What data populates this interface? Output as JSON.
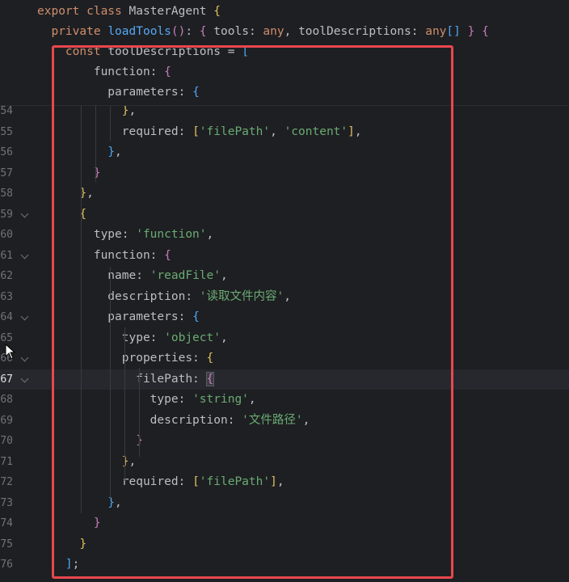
{
  "sticky_lines": [
    {
      "parts": [
        [
          "kw",
          "export "
        ],
        [
          "kw",
          "class "
        ],
        [
          "cls",
          "MasterAgent "
        ],
        [
          "br1",
          "{"
        ]
      ]
    },
    {
      "parts": [
        [
          "kw",
          "  private "
        ],
        [
          "fn",
          "loadTools"
        ],
        [
          "br2",
          "()"
        ],
        [
          "key",
          ": "
        ],
        [
          "br2",
          "{ "
        ],
        [
          "key",
          "tools: "
        ],
        [
          "kw",
          "any"
        ],
        [
          "key",
          ", toolDescriptions: "
        ],
        [
          "kw",
          "any"
        ],
        [
          "br3",
          "[]"
        ],
        [
          "br2",
          " }"
        ],
        [
          "key",
          " "
        ],
        [
          "br2",
          "{"
        ]
      ]
    },
    {
      "parts": [
        [
          "kw",
          "    const "
        ],
        [
          "key",
          "toolDescriptions = "
        ],
        [
          "br3",
          "["
        ]
      ]
    },
    {
      "parts": [
        [
          "key",
          "        function: "
        ],
        [
          "br2",
          "{"
        ]
      ]
    },
    {
      "parts": [
        [
          "key",
          "          parameters: "
        ],
        [
          "br3",
          "{"
        ]
      ]
    }
  ],
  "lines": [
    {
      "num": "54",
      "fold": false,
      "parts": [
        [
          "br1",
          "            }"
        ],
        [
          "key",
          ","
        ]
      ]
    },
    {
      "num": "55",
      "fold": false,
      "parts": [
        [
          "key",
          "            required: "
        ],
        [
          "br1",
          "["
        ],
        [
          "str",
          "'filePath'"
        ],
        [
          "key",
          ", "
        ],
        [
          "str",
          "'content'"
        ],
        [
          "br1",
          "]"
        ],
        [
          "key",
          ","
        ]
      ]
    },
    {
      "num": "56",
      "fold": false,
      "parts": [
        [
          "br3",
          "          }"
        ],
        [
          "key",
          ","
        ]
      ]
    },
    {
      "num": "57",
      "fold": false,
      "parts": [
        [
          "br2",
          "        }"
        ]
      ]
    },
    {
      "num": "58",
      "fold": false,
      "parts": [
        [
          "br1",
          "      }"
        ],
        [
          "key",
          ","
        ]
      ]
    },
    {
      "num": "59",
      "fold": true,
      "parts": [
        [
          "br1",
          "      {"
        ]
      ]
    },
    {
      "num": "60",
      "fold": false,
      "parts": [
        [
          "key",
          "        type: "
        ],
        [
          "str",
          "'function'"
        ],
        [
          "key",
          ","
        ]
      ]
    },
    {
      "num": "61",
      "fold": true,
      "parts": [
        [
          "key",
          "        function: "
        ],
        [
          "br2",
          "{"
        ]
      ]
    },
    {
      "num": "62",
      "fold": false,
      "parts": [
        [
          "key",
          "          name: "
        ],
        [
          "str",
          "'readFile'"
        ],
        [
          "key",
          ","
        ]
      ]
    },
    {
      "num": "63",
      "fold": false,
      "parts": [
        [
          "key",
          "          description: "
        ],
        [
          "str",
          "'读取文件内容'"
        ],
        [
          "key",
          ","
        ]
      ]
    },
    {
      "num": "64",
      "fold": true,
      "parts": [
        [
          "key",
          "          parameters: "
        ],
        [
          "br3",
          "{"
        ]
      ]
    },
    {
      "num": "65",
      "fold": false,
      "parts": [
        [
          "key",
          "            type: "
        ],
        [
          "str",
          "'object'"
        ],
        [
          "key",
          ","
        ]
      ]
    },
    {
      "num": "66",
      "fold": true,
      "parts": [
        [
          "key",
          "            properties: "
        ],
        [
          "br1",
          "{"
        ]
      ]
    },
    {
      "num": "67",
      "fold": true,
      "current": true,
      "parts": [
        [
          "key",
          "              filePath: "
        ],
        [
          "br2",
          "{"
        ]
      ]
    },
    {
      "num": "68",
      "fold": false,
      "parts": [
        [
          "key",
          "                type: "
        ],
        [
          "str",
          "'string'"
        ],
        [
          "key",
          ","
        ]
      ]
    },
    {
      "num": "69",
      "fold": false,
      "parts": [
        [
          "key",
          "                description: "
        ],
        [
          "str",
          "'文件路径'"
        ],
        [
          "key",
          ","
        ]
      ]
    },
    {
      "num": "70",
      "fold": false,
      "parts": [
        [
          "br2",
          "              }"
        ]
      ]
    },
    {
      "num": "71",
      "fold": false,
      "parts": [
        [
          "br1",
          "            }"
        ],
        [
          "key",
          ","
        ]
      ]
    },
    {
      "num": "72",
      "fold": false,
      "parts": [
        [
          "key",
          "            required: "
        ],
        [
          "br1",
          "["
        ],
        [
          "str",
          "'filePath'"
        ],
        [
          "br1",
          "]"
        ],
        [
          "key",
          ","
        ]
      ]
    },
    {
      "num": "73",
      "fold": false,
      "parts": [
        [
          "br3",
          "          }"
        ],
        [
          "key",
          ","
        ]
      ]
    },
    {
      "num": "74",
      "fold": false,
      "parts": [
        [
          "br2",
          "        }"
        ]
      ]
    },
    {
      "num": "75",
      "fold": false,
      "parts": [
        [
          "br1",
          "      }"
        ]
      ]
    },
    {
      "num": "76",
      "fold": false,
      "parts": [
        [
          "br3",
          "    ]"
        ],
        [
          "key",
          ";"
        ]
      ]
    }
  ],
  "colors": {
    "highlight_box": "#e9474e",
    "background": "#1e1f22"
  },
  "icons": {
    "cursor": "mouse-pointer-icon",
    "fold": "chevron-down-icon"
  }
}
